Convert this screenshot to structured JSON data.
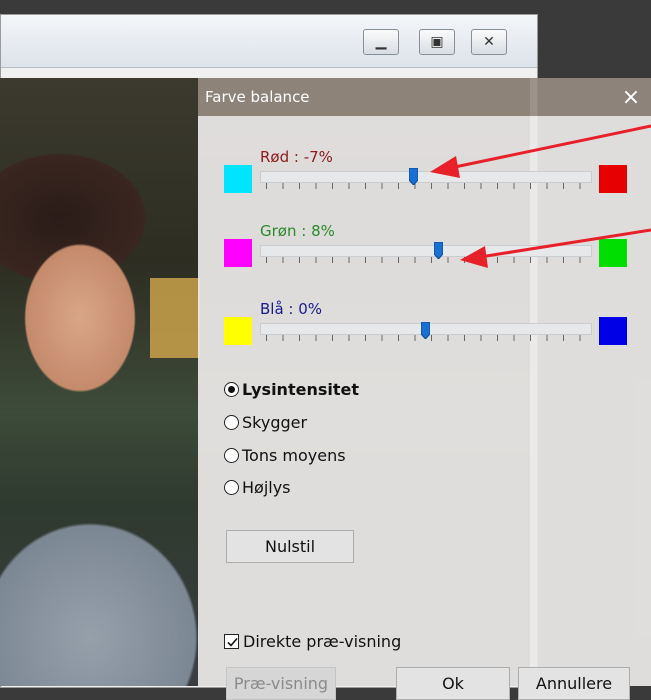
{
  "dialog": {
    "title": "Farve balance",
    "close_glyph": "×"
  },
  "background_window": {
    "controls": [
      "minimize",
      "maximize",
      "close"
    ]
  },
  "sliders": [
    {
      "label": "Rød : -7%",
      "value": -7,
      "left_color": "#00e5ff",
      "right_color": "#e60000",
      "label_color": "#8b1a1a"
    },
    {
      "label": "Grøn : 8%",
      "value": 8,
      "left_color": "#ff00ff",
      "right_color": "#00dd00",
      "label_color": "#2a8a2a"
    },
    {
      "label": "Blå : 0%",
      "value": 0,
      "left_color": "#ffff00",
      "right_color": "#0000e6",
      "label_color": "#1a1a8b"
    }
  ],
  "range_options": [
    {
      "label": "Lysintensitet",
      "selected": true
    },
    {
      "label": "Skygger",
      "selected": false
    },
    {
      "label": "Tons moyens",
      "selected": false
    },
    {
      "label": "Højlys",
      "selected": false
    }
  ],
  "buttons": {
    "reset": "Nulstil",
    "preview": "Præ-visning",
    "ok": "Ok",
    "cancel": "Annullere"
  },
  "live_preview": {
    "label": "Direkte præ-visning",
    "checked": true
  },
  "annotation_color": "#e8202a"
}
